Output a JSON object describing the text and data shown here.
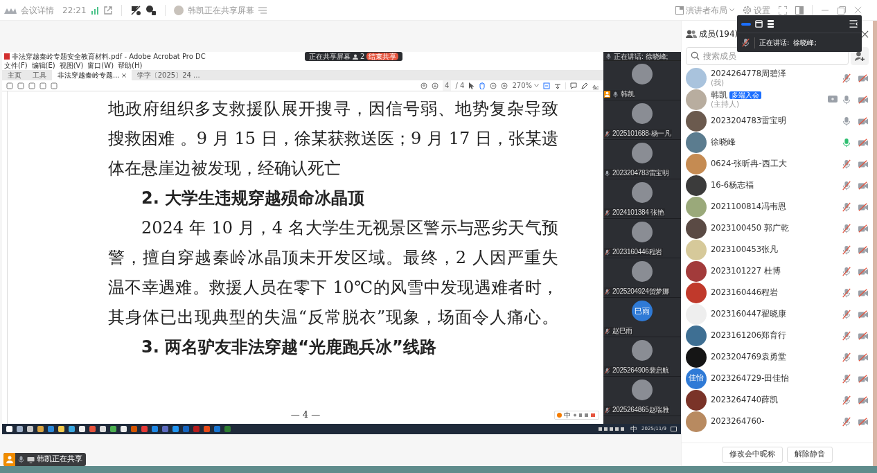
{
  "top_bar": {
    "app_label": "会议详情",
    "time": "22:21",
    "sharing_status": "韩凯正在共享屏幕",
    "layout_button": "演讲者布局",
    "settings_button": "设置"
  },
  "speaking_overlay": {
    "label": "正在讲话:",
    "speaker": "徐晓峰;"
  },
  "shared_screen": {
    "window_title": "非法穿越秦岭专题安全教育材料.pdf - Adobe Acrobat Pro DC",
    "share_bar": {
      "status": "正在共享屏幕",
      "count": "2",
      "stop_button": "结束共享"
    },
    "menus": [
      "文件(F)",
      "编辑(E)",
      "视图(V)",
      "窗口(W)",
      "帮助(H)"
    ],
    "tabs": [
      {
        "label": "主页",
        "selected": false,
        "closable": false
      },
      {
        "label": "工具",
        "selected": false,
        "closable": false
      },
      {
        "label": "非法穿越秦岭专题...",
        "selected": true,
        "closable": true
      },
      {
        "label": "学字〔2025〕24 ...",
        "selected": false,
        "closable": false
      }
    ],
    "page_field": "4",
    "page_total": "/ 4",
    "zoom": "270%",
    "document": {
      "lines": [
        {
          "kind": "full",
          "indent": false,
          "text": "地政府组织多支救援队展开搜寻，因信号弱、地势复杂导致"
        },
        {
          "kind": "full",
          "indent": false,
          "text": "搜救困难 。9 月 15 日，徐某获救送医；9 月 17 日，张某遗"
        },
        {
          "kind": "end",
          "indent": false,
          "text": "体在悬崖边被发现，经确认死亡"
        },
        {
          "kind": "heading",
          "indent": true,
          "text": "2. 大学生违规穿越殒命冰晶顶"
        },
        {
          "kind": "full",
          "indent": true,
          "text": "2024 年 10 月，4 名大学生无视景区警示与恶劣天气预"
        },
        {
          "kind": "full",
          "indent": false,
          "text": "警，擅自穿越秦岭冰晶顶未开发区域。最终，2 人因严重失"
        },
        {
          "kind": "full",
          "indent": false,
          "text": "温不幸遇难。救援人员在零下 10℃的风雪中发现遇难者时，"
        },
        {
          "kind": "full",
          "indent": false,
          "text": "其身体已出现典型的失温“反常脱衣”现象，场面令人痛心。"
        },
        {
          "kind": "heading",
          "indent": true,
          "text": "3. 两名驴友非法穿越“光鹿跑兵冰”线路"
        }
      ],
      "page_number": "— 4 —",
      "ime_label": "中"
    },
    "video_panel": {
      "speaking_label": "正在讲话: 徐晓峰;",
      "tiles": [
        {
          "name": "韩凯",
          "host": true,
          "muted": false
        },
        {
          "name": "2025101688-杨一凡",
          "host": false,
          "muted": true
        },
        {
          "name": "2023204783雷宝明",
          "host": false,
          "muted": false
        },
        {
          "name": "2024101384 张艳",
          "host": false,
          "muted": true
        },
        {
          "name": "2023160446程岩",
          "host": false,
          "muted": true
        },
        {
          "name": "2025204924贺梦娜",
          "host": false,
          "muted": true
        },
        {
          "name": "赵巳雨",
          "host": false,
          "muted": true,
          "avatar_text": "巳雨"
        },
        {
          "name": "2025264906裴启航",
          "host": false,
          "muted": true
        },
        {
          "name": "2025264865赵瑞雅",
          "host": false,
          "muted": true
        }
      ]
    },
    "taskbar": {
      "ime_label": "中",
      "date": "2025/11/9"
    }
  },
  "share_indicator": "韩凯正在共享",
  "members": {
    "title": "成员(194)",
    "search_placeholder": "搜索成员",
    "list": [
      {
        "name": "2024264778周碧泽",
        "subtitle": "(我)",
        "muted": true,
        "speaking": false,
        "camera_on": false,
        "sharing": false
      },
      {
        "name": "韩凯",
        "badge": "多端入会",
        "subtitle": "(主持人)",
        "muted": false,
        "speaking": false,
        "camera_on": false,
        "sharing": true
      },
      {
        "name": "2023204783雷宝明",
        "muted": false,
        "speaking": false,
        "camera_on": false,
        "sharing": false
      },
      {
        "name": "徐晓峰",
        "muted": false,
        "speaking": true,
        "camera_on": false,
        "sharing": false
      },
      {
        "name": "0624-张昕冉-西工大",
        "muted": true,
        "speaking": false,
        "camera_on": false,
        "sharing": false
      },
      {
        "name": "16-6杨志福",
        "muted": true,
        "speaking": false,
        "camera_on": false,
        "sharing": false
      },
      {
        "name": "2021100814冯韦恩",
        "muted": true,
        "speaking": false,
        "camera_on": false,
        "sharing": false
      },
      {
        "name": "2023100450 郭广乾",
        "muted": true,
        "speaking": false,
        "camera_on": false,
        "sharing": false
      },
      {
        "name": "2023100453张凡",
        "muted": true,
        "speaking": false,
        "camera_on": false,
        "sharing": false
      },
      {
        "name": "2023101227 杜博",
        "muted": true,
        "speaking": false,
        "camera_on": false,
        "sharing": false
      },
      {
        "name": "2023160446程岩",
        "muted": true,
        "speaking": false,
        "camera_on": false,
        "sharing": false
      },
      {
        "name": "2023160447翟晓康",
        "muted": true,
        "speaking": false,
        "camera_on": false,
        "sharing": false
      },
      {
        "name": "2023161206郑育行",
        "muted": true,
        "speaking": false,
        "camera_on": false,
        "sharing": false
      },
      {
        "name": "2023204769袁勇堂",
        "muted": true,
        "speaking": false,
        "camera_on": false,
        "sharing": false
      },
      {
        "name": "2023264729-田佳怡",
        "avatar_text": "佳怡",
        "muted": true,
        "speaking": false,
        "camera_on": false,
        "sharing": false
      },
      {
        "name": "2023264740薛凯",
        "muted": true,
        "speaking": false,
        "camera_on": false,
        "sharing": false
      },
      {
        "name": "2023264760-",
        "muted": true,
        "speaking": false,
        "camera_on": false,
        "sharing": false
      }
    ],
    "buttons": [
      "修改会中昵称",
      "解除静音"
    ]
  }
}
